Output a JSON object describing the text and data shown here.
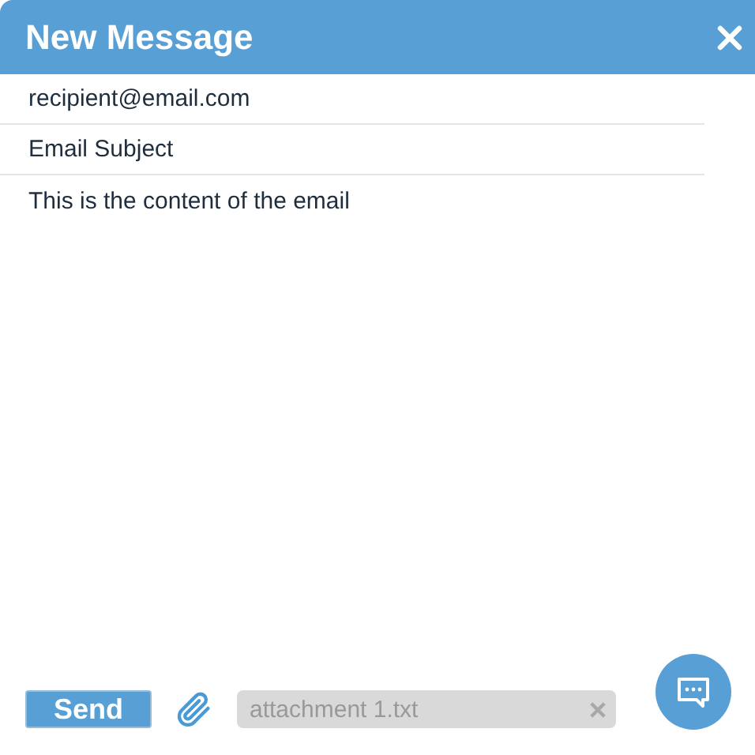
{
  "window": {
    "title": "New Message"
  },
  "to": {
    "value": "recipient@email.com"
  },
  "subject": {
    "value": "Email Subject"
  },
  "body": {
    "value": "This is the content of the email"
  },
  "send_button": {
    "label": "Send"
  },
  "attachments": [
    {
      "name": "attachment 1.txt"
    }
  ]
}
